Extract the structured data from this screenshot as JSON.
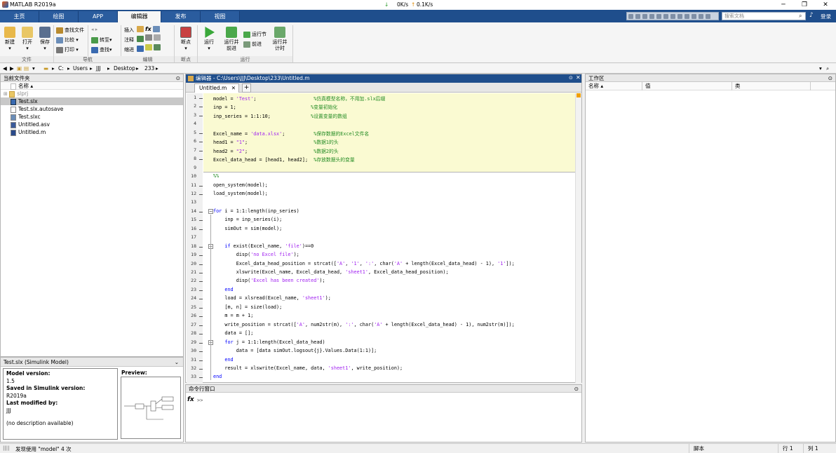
{
  "window": {
    "title": "MATLAB R2019a"
  },
  "net": {
    "down": "0K/s",
    "up": "0.1K/s"
  },
  "tabs": [
    "主页",
    "绘图",
    "APP",
    "编辑器",
    "发布",
    "视图"
  ],
  "search": {
    "placeholder": "搜索文档"
  },
  "login_label": "登录",
  "ribbon": {
    "new": "新建",
    "open": "打开",
    "save": "保存",
    "find_files": "查找文件",
    "compare": "比较",
    "print": "打印",
    "goto": "转至",
    "find": "查找",
    "insert": "插入",
    "comment": "注释",
    "indent": "缩进",
    "breakpoints": "断点",
    "run": "运行",
    "run_advance": "运行并\n前进",
    "run_section": "运行节",
    "advance": "前进",
    "run_time": "运行并\n计时",
    "groups": {
      "file": "文件",
      "navigate": "导航",
      "edit": "编辑",
      "breakpoints": "断点",
      "run": "运行"
    }
  },
  "address": {
    "parts": [
      "C:",
      "Users",
      "JJJ",
      "Desktop",
      "233"
    ]
  },
  "file_panel": {
    "title": "当前文件夹",
    "col_name": "名称",
    "files": [
      "slprj",
      "Test.slx",
      "Test.slx.autosave",
      "Test.slxc",
      "Untitled.asv",
      "Untitled.m"
    ]
  },
  "details": {
    "header": "Test.slx  (Simulink Model)",
    "model_version_label": "Model version:",
    "model_version": "1.5",
    "saved_label": "Saved in Simulink version:",
    "saved": "R2019a",
    "modified_label": "Last modified by:",
    "modified": "JJJ",
    "description": "(no description available)",
    "preview_label": "Preview:"
  },
  "editor": {
    "title": "编辑器 - C:\\Users\\JJJ\\Desktop\\233\\Untitled.m",
    "tab": "Untitled.m",
    "plus": "+"
  },
  "code": [
    {
      "n": "1",
      "html": "model = <span class=\"str\">'Test'</span>;                    <span class=\"cmt\">%仿真模型名称，不用加.slx后缀</span>"
    },
    {
      "n": "2",
      "html": "inp = 1;                          <span class=\"cmt\">%变量初始化</span>"
    },
    {
      "n": "3",
      "html": "inp_series = 1:1:10;              <span class=\"cmt\">%设置变量的数组</span>"
    },
    {
      "n": "4",
      "html": ""
    },
    {
      "n": "5",
      "html": "Excel_name = <span class=\"str\">'data.xlsx'</span>;          <span class=\"cmt\">%保存数据的Excel文件名</span>"
    },
    {
      "n": "6",
      "html": "head1 = <span class=\"str\">\"1\"</span>;                       <span class=\"cmt\">%数据1的头</span>"
    },
    {
      "n": "7",
      "html": "head2 = <span class=\"str\">\"2\"</span>;                       <span class=\"cmt\">%数据2的头</span>"
    },
    {
      "n": "8",
      "html": "Excel_data_head = [head1, head2];  <span class=\"cmt\">%存放数据头的变量</span>"
    },
    {
      "n": "9",
      "html": ""
    },
    {
      "n": "10",
      "html": "<span class=\"cmt\">%%</span>"
    },
    {
      "n": "11",
      "html": "open_system(model);"
    },
    {
      "n": "12",
      "html": "load_system(model);"
    },
    {
      "n": "13",
      "html": ""
    },
    {
      "n": "14",
      "html": "<span class=\"kw\">for</span> i = 1:1:length(inp_series)"
    },
    {
      "n": "15",
      "html": "    inp = inp_series(i);"
    },
    {
      "n": "16",
      "html": "    simOut = sim(model);"
    },
    {
      "n": "17",
      "html": ""
    },
    {
      "n": "18",
      "html": "    <span class=\"kw\">if</span> exist(Excel_name, <span class=\"str\">'file'</span>)==0"
    },
    {
      "n": "19",
      "html": "        disp(<span class=\"str\">'no Excel file'</span>);"
    },
    {
      "n": "20",
      "html": "        Excel_data_head_position = strcat([<span class=\"str\">'A'</span>, <span class=\"str\">'1'</span>, <span class=\"str\">':'</span>, char(<span class=\"str\">'A'</span> + length(Excel_data_head) - 1), <span class=\"str\">'1'</span>]);"
    },
    {
      "n": "21",
      "html": "        xlswrite(Excel_name, Excel_data_head, <span class=\"str\">'sheet1'</span>, Excel_data_head_position);"
    },
    {
      "n": "22",
      "html": "        disp(<span class=\"str\">'Excel has been created'</span>);"
    },
    {
      "n": "23",
      "html": "    <span class=\"kw\">end</span>"
    },
    {
      "n": "24",
      "html": "    load = xlsread(Excel_name, <span class=\"str\">'sheet1'</span>);"
    },
    {
      "n": "25",
      "html": "    [m, n] = size(load);"
    },
    {
      "n": "26",
      "html": "    m = m + 1;"
    },
    {
      "n": "27",
      "html": "    write_position = strcat([<span class=\"str\">'A'</span>, num2str(m), <span class=\"str\">':'</span>, char(<span class=\"str\">'A'</span> + length(Excel_data_head) - 1), num2str(m)]);"
    },
    {
      "n": "28",
      "html": "    data = [];"
    },
    {
      "n": "29",
      "html": "    <span class=\"kw\">for</span> j = 1:1:length(Excel_data_head)"
    },
    {
      "n": "30",
      "html": "        data = [data simOut.logsout{j}.Values.Data(1:1)];"
    },
    {
      "n": "31",
      "html": "    <span class=\"kw\">end</span>"
    },
    {
      "n": "32",
      "html": "    result = xlswrite(Excel_name, data, <span class=\"str\">'sheet1'</span>, write_position);"
    },
    {
      "n": "33",
      "html": "<span class=\"kw\">end</span>"
    }
  ],
  "command_window": {
    "title": "命令行窗口",
    "fx": "fx",
    "prompt": ">>"
  },
  "workspace": {
    "title": "工作区",
    "col_name": "名称",
    "col_value": "值",
    "col_class": "类"
  },
  "status": {
    "message": "发现使用 \"model\" 4 次",
    "script": "脚本",
    "row_label": "行",
    "row": "1",
    "col_label": "列",
    "col": "1"
  },
  "colors": {
    "accent": "#1f4e8c",
    "section_bg": "#fafad2",
    "string": "#a020f0",
    "comment": "#228b22",
    "keyword": "#0000ff"
  }
}
